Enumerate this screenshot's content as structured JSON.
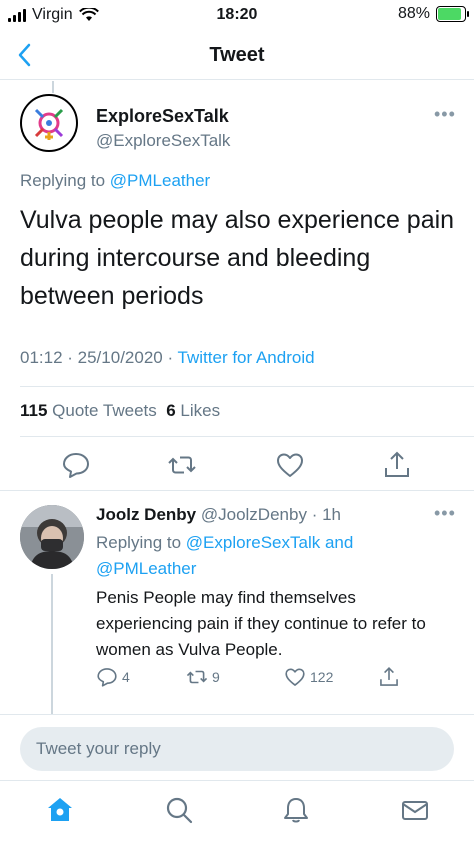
{
  "status": {
    "carrier": "Virgin",
    "time": "18:20",
    "battery": "88%"
  },
  "nav": {
    "title": "Tweet"
  },
  "main_tweet": {
    "name": "ExploreSexTalk",
    "handle": "@ExploreSexTalk",
    "replying_prefix": "Replying to",
    "replying_to": "@PMLeather",
    "text": "Vulva people may also experience pain during intercourse and bleeding between periods",
    "timestamp": "01:12 · 25/10/2020 · ",
    "source": "Twitter for Android",
    "quote_count": "115",
    "quote_label": "Quote Tweets",
    "like_count": "6",
    "like_label": "Likes"
  },
  "reply_tweet": {
    "name": "Joolz Denby",
    "handle": "@JoolzDenby",
    "age": "· 1h",
    "replying_prefix": "Replying to",
    "replying_to_1": "@ExploreSexTalk",
    "replying_and": "and",
    "replying_to_2": "@PMLeather",
    "text": "Penis People may find themselves experiencing pain if they continue to refer to women as Vulva People.",
    "reply_count": "4",
    "retweet_count": "9",
    "like_count": "122"
  },
  "composer": {
    "placeholder": "Tweet your reply"
  },
  "icons": {
    "back": "chevron-left-icon",
    "more": "more-horizontal-icon",
    "reply": "comment-icon",
    "retweet": "retweet-icon",
    "like": "heart-icon",
    "share": "share-icon",
    "home": "home-icon",
    "search": "search-icon",
    "notifications": "bell-icon",
    "messages": "mail-icon"
  },
  "colors": {
    "accent": "#1da1f2",
    "muted": "#657786",
    "battery": "#4cd964"
  }
}
